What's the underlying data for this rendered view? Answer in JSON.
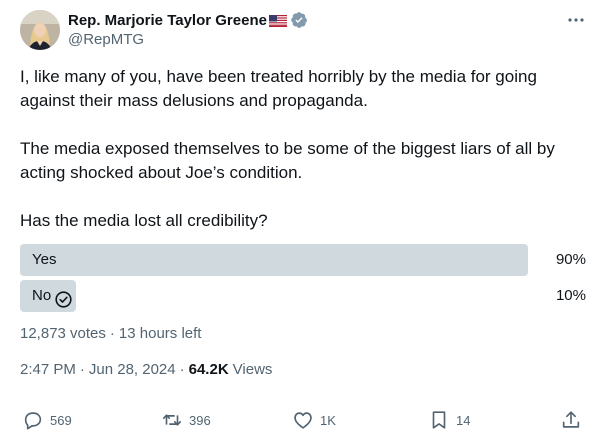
{
  "author": {
    "name": "Rep. Marjorie Taylor Greene",
    "handle": "@RepMTG",
    "verified": true,
    "flag_icon": "us-flag-icon",
    "verified_icon": "verified-badge-icon"
  },
  "tweet": {
    "paragraphs": [
      "I, like many of you, have been treated horribly by the media for going against their mass delusions and propaganda.",
      "The media exposed themselves to be some of the biggest liars of all by acting shocked about Joe’s condition.",
      "Has the media lost all credibility?"
    ]
  },
  "poll": {
    "options": [
      {
        "label": "Yes",
        "percent": "90%",
        "fraction": 0.9,
        "selected": false
      },
      {
        "label": "No",
        "percent": "10%",
        "fraction": 0.1,
        "selected": true
      }
    ],
    "votes": "12,873 votes",
    "time_left": "13 hours left",
    "separator": "·",
    "bar_color": "#cfd9de"
  },
  "meta": {
    "time": "2:47 PM",
    "date": "Jun 28, 2024",
    "separator": "·",
    "views_count": "64.2K",
    "views_label": "Views"
  },
  "actions": {
    "replies": "569",
    "reposts": "396",
    "likes": "1K",
    "bookmarks": "14"
  },
  "colors": {
    "text": "#0f1419",
    "secondary": "#536471",
    "verified_blue": "#829aab"
  }
}
